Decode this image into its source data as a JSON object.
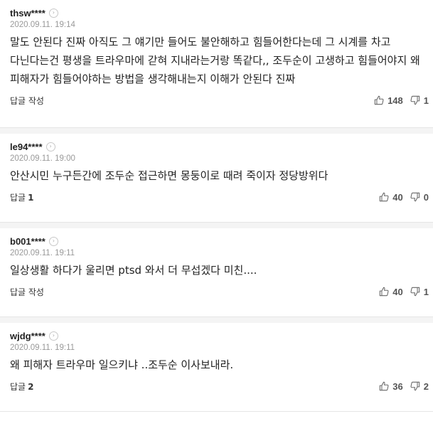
{
  "comments": [
    {
      "author": "thsw****",
      "timestamp": "2020.09.11. 19:14",
      "body": "말도 안된다 진짜 아직도 그 얘기만 들어도 불안해하고 힘들어한다는데 그 시계를 차고 다닌다는건 평생을 트라우마에 갇혀 지내라는거랑 똑같다,, 조두순이 고생하고 힘들어야지 왜 피해자가 힘들어야하는 방법을 생각해내는지 이해가 안된다 진짜",
      "reply_label": "답글 작성",
      "reply_count": "",
      "likes": "148",
      "dislikes": "1"
    },
    {
      "author": "le94****",
      "timestamp": "2020.09.11. 19:00",
      "body": "안산시민 누구든간에 조두순 접근하면 몽둥이로 때려 죽이자 정당방위다",
      "reply_label": "답글",
      "reply_count": "1",
      "likes": "40",
      "dislikes": "0"
    },
    {
      "author": "b001****",
      "timestamp": "2020.09.11. 19:11",
      "body": "일상생활 하다가 울리면 ptsd 와서 더 무섭겠다 미친....",
      "reply_label": "답글 작성",
      "reply_count": "",
      "likes": "40",
      "dislikes": "1"
    },
    {
      "author": "wjdg****",
      "timestamp": "2020.09.11. 19:11",
      "body": "왜 피해자 트라우마 일으키냐 ..조두순 이사보내라.",
      "reply_label": "답글",
      "reply_count": "2",
      "likes": "36",
      "dislikes": "2"
    }
  ],
  "icons": {
    "more": "chevron-right-icon",
    "like": "thumbs-up-icon",
    "dislike": "thumbs-down-icon"
  }
}
